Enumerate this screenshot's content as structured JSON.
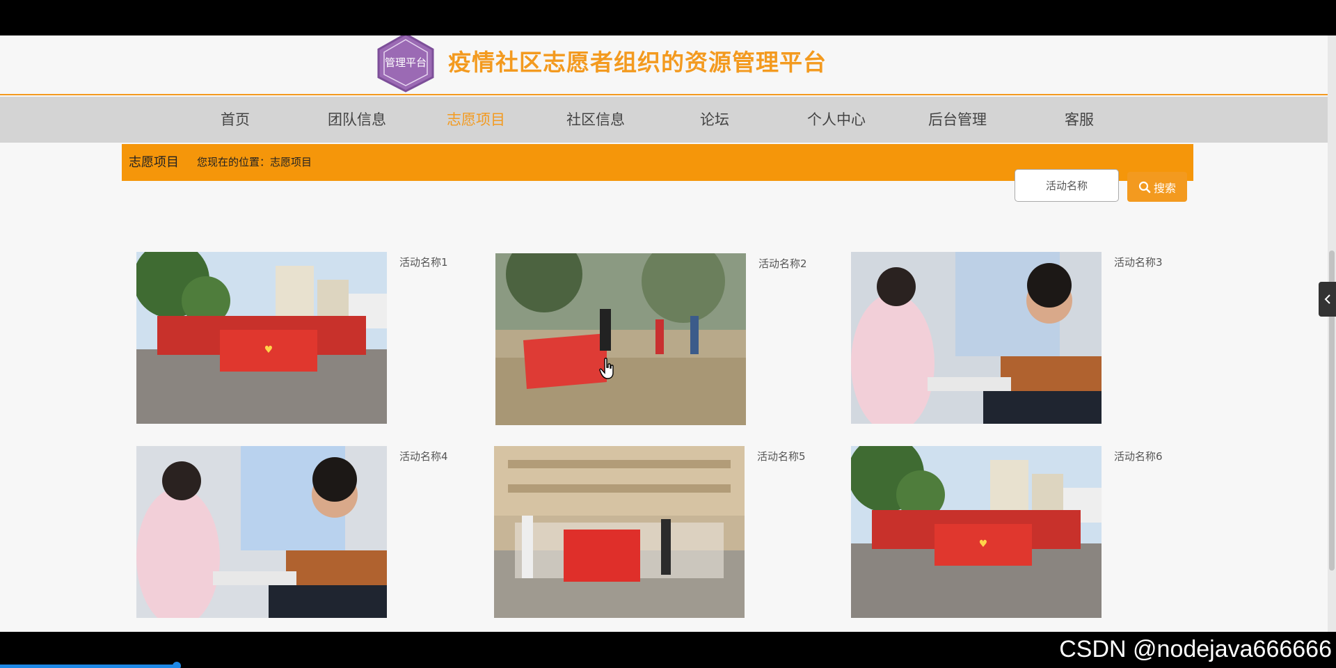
{
  "site": {
    "title": "疫情社区志愿者组织的资源管理平台",
    "logo_text": "管理平台",
    "accent_color": "#f39a1f"
  },
  "nav": {
    "items": [
      {
        "label": "首页"
      },
      {
        "label": "团队信息"
      },
      {
        "label": "志愿项目",
        "active": true
      },
      {
        "label": "社区信息"
      },
      {
        "label": "论坛"
      },
      {
        "label": "个人中心"
      },
      {
        "label": "后台管理"
      },
      {
        "label": "客服"
      }
    ]
  },
  "breadcrumb": {
    "title": "志愿项目",
    "position": "您现在的位置：志愿项目"
  },
  "search": {
    "placeholder": "活动名称",
    "button_label": "搜索",
    "icon": "search-icon"
  },
  "projects": [
    {
      "name": "活动名称1",
      "photo": "group-with-banner"
    },
    {
      "name": "活动名称2",
      "photo": "tree-planting"
    },
    {
      "name": "活动名称3",
      "photo": "blood-donation"
    },
    {
      "name": "活动名称4",
      "photo": "blood-donation"
    },
    {
      "name": "活动名称5",
      "photo": "group-with-banner-building"
    },
    {
      "name": "活动名称6",
      "photo": "group-with-banner"
    }
  ],
  "watermark": "CSDN @nodejava666666"
}
